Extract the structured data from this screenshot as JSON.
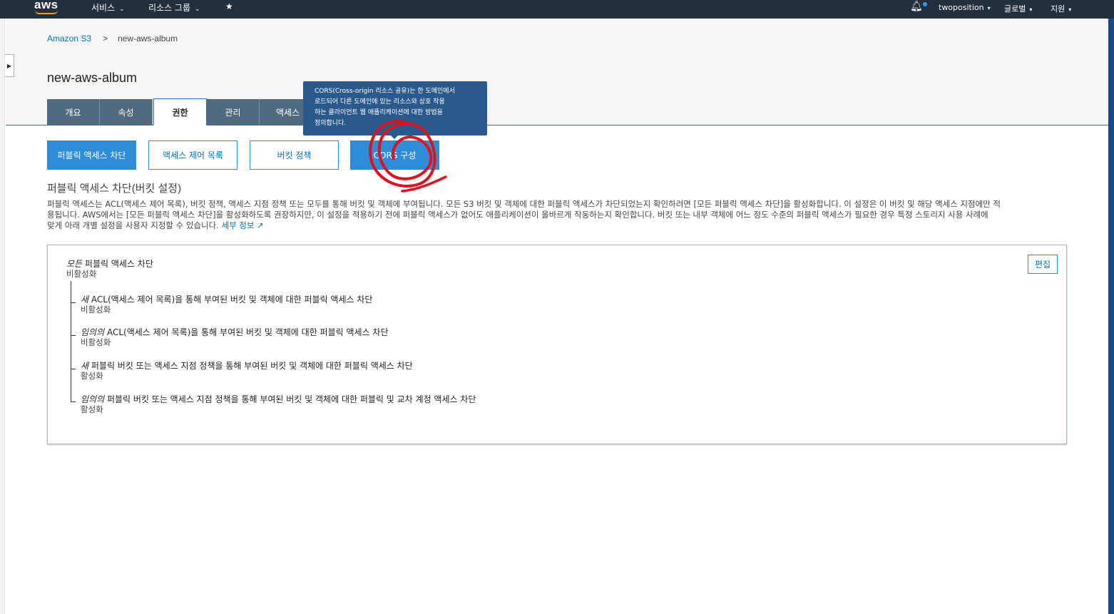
{
  "topnav": {
    "logo": "aws",
    "services": "서비스",
    "resource_groups": "리소스 그룹",
    "user": "twoposition",
    "region": "글로벌",
    "support": "지원"
  },
  "breadcrumb": {
    "root": "Amazon S3",
    "separator": ">",
    "current": "new-aws-album"
  },
  "page": {
    "title": "new-aws-album"
  },
  "tabs": [
    {
      "label": "개요"
    },
    {
      "label": "속성"
    },
    {
      "label": "권한"
    },
    {
      "label": "관리"
    },
    {
      "label": "액세스"
    }
  ],
  "tooltip": {
    "line1": "CORS(Cross-origin 리소스 공유)는 한 도메인에서",
    "line2": "로드되어 다른 도메인에 있는 리소스와 상호 작용",
    "line3": "하는 클라이언트 웹 애플리케이션에 대한 방법을",
    "line4": "정의합니다."
  },
  "sub_buttons": {
    "block_public_access": "퍼블릭 액세스 차단",
    "acl": "액세스 제어 목록",
    "bucket_policy": "버킷 정책",
    "cors": "CORS 구성"
  },
  "section": {
    "title": "퍼블릭 액세스 차단(버킷 설정)",
    "desc_line1": "퍼블릭 액세스는 ACL(액세스 제어 목록), 버킷 정책, 액세스 지점 정책 또는 모두를 통해 버킷 및 객체에 부여됩니다. 모든 S3 버킷 및 객체에 대한 퍼블릭 액세스가 차단되었는지 확인하려면 [모든 퍼블릭 액세스 차단]을 활성화합니다. 이 설정은 이 버킷 및 해당 액세스 지점에만 적",
    "desc_line2": "용됩니다. AWS에서는 [모든 퍼블릭 액세스 차단]을 활성화하도록 권장하지만, 이 설정을 적용하기 전에 퍼블릭 액세스가 없어도 애플리케이션이 올바르게 작동하는지 확인합니다. 버킷 또는 내부 객체에 어느 정도 수준의 퍼블릭 액세스가 필요한 경우 특정 스토리지 사용 사례에",
    "desc_line3": "맞게 아래 개별 설정을 사용자 지정할 수 있습니다.",
    "learn_more": "세부 정보"
  },
  "settings": {
    "edit": "편집",
    "all": {
      "prefix": "모든",
      "title": "퍼블릭 액세스 차단",
      "value": "비활성화"
    },
    "items": [
      {
        "prefix": "새",
        "title": "ACL(액세스 제어 목록)을 통해 부여된 버킷 및 객체에 대한 퍼블릭 액세스 차단",
        "value": "비활성화"
      },
      {
        "prefix": "임의의",
        "title": "ACL(액세스 제어 목록)을 통해 부여된 버킷 및 객체에 대한 퍼블릭 액세스 차단",
        "value": "비활성화"
      },
      {
        "prefix": "새",
        "title": "퍼블릭 버킷 또는 액세스 지점 정책을 통해 부여된 버킷 및 객체에 대한 퍼블릭 액세스 차단",
        "value": "활성화"
      },
      {
        "prefix": "임의의",
        "title": "퍼블릭 버킷 또는 액세스 지점 정책을 통해 부여된 버킷 및 객체에 대한 퍼블릭 및 교차 계정 액세스 차단",
        "value": "활성화"
      }
    ]
  },
  "colors": {
    "nav_bg": "#232f3e",
    "tab_bg": "#506a7f",
    "accent": "#2e8dd6",
    "link": "#0073bb",
    "tooltip_bg": "#2a5a8c",
    "annotation": "#e0101f"
  }
}
